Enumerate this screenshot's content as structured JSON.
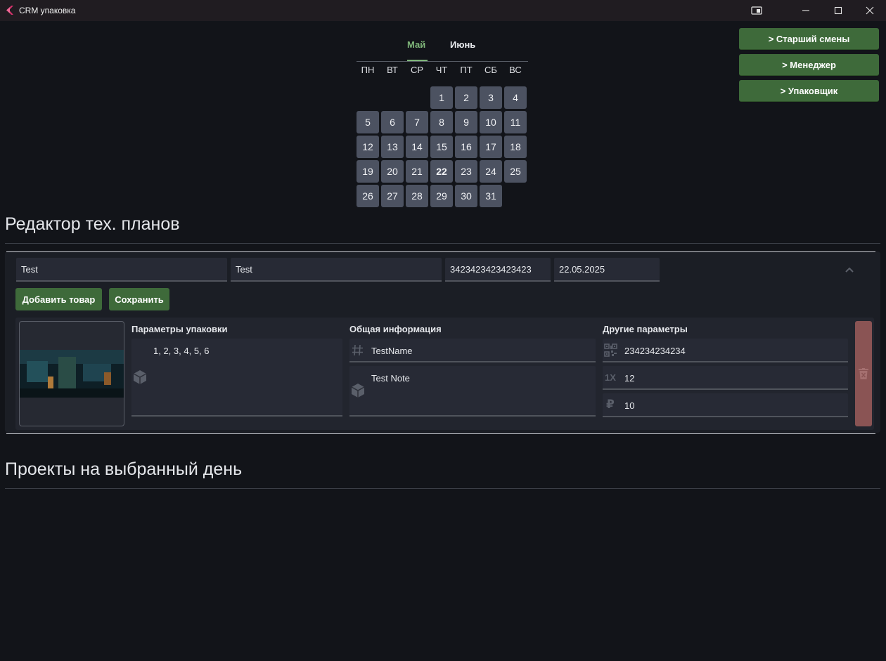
{
  "window": {
    "title": "CRM упаковка",
    "controls": [
      "pin-icon",
      "minimize-icon",
      "maximize-icon",
      "close-icon"
    ]
  },
  "roles": {
    "shift_lead": "> Старший смены",
    "manager": "> Менеджер",
    "packer": "> Упаковщик"
  },
  "calendar": {
    "months": [
      "Май",
      "Июнь"
    ],
    "active_month": "Май",
    "weekdays": [
      "ПН",
      "ВТ",
      "СР",
      "ЧТ",
      "ПТ",
      "СБ",
      "ВС"
    ],
    "first_weekday_index": 3,
    "days_in_month": 31,
    "selected_day": 22
  },
  "editor": {
    "title": "Редактор тех. планов",
    "fields": {
      "name": "Test",
      "client": "Test",
      "code": "3423423423423423",
      "date": "22.05.2025"
    },
    "add_button": "Добавить товар",
    "save_button": "Сохранить",
    "item": {
      "packaging_label": "Параметры упаковки",
      "packaging_value": "1, 2, 3, 4, 5, 6",
      "general_label": "Общая информация",
      "product_name": "TestName",
      "note": "Test Note",
      "other_label": "Другие параметры",
      "barcode": "234234234234",
      "quantity": "12",
      "price": "10",
      "quantity_icon_text": "1X",
      "price_icon_text": "₽"
    }
  },
  "projects": {
    "title": "Проекты на выбранный день"
  },
  "colors": {
    "accent_green": "#3e6a3a",
    "month_active": "#7fb67a",
    "day_cell": "#4c5261",
    "delete": "#8a5454",
    "background": "#121419"
  }
}
